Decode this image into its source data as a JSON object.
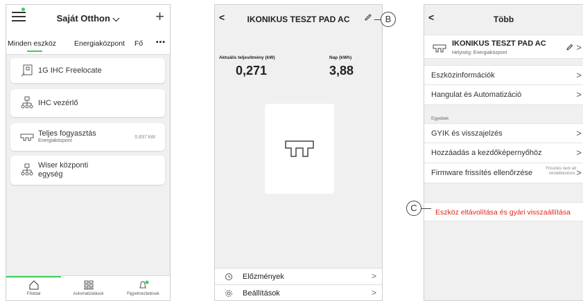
{
  "phone1": {
    "title": "Saját Otthon",
    "tabs": [
      "Minden eszköz",
      "Energiaközpont",
      "Fő"
    ],
    "more": "•••",
    "devices": [
      {
        "label": "1G IHC Freelocate",
        "icon": "freelocate-switch-icon"
      },
      {
        "label": "IHC vezérlő",
        "icon": "controller-hub-icon"
      },
      {
        "label": "Teljes fogyasztás",
        "sub": "Energiaközpont",
        "value": "0,837 kW",
        "icon": "ac-pad-icon"
      },
      {
        "label": "Wiser központi\negység",
        "icon": "controller-hub-icon"
      }
    ],
    "nav": [
      {
        "label": "Főoldal",
        "icon": "home-icon"
      },
      {
        "label": "Automatizálások",
        "icon": "grid-icon"
      },
      {
        "label": "Figyelmeztetések",
        "icon": "bell-icon"
      }
    ]
  },
  "phone2": {
    "title": "IKONIKUS TESZT PAD AC",
    "metrics": [
      {
        "label": "Aktuális teljesítmény (kW)",
        "value": "0,271"
      },
      {
        "label": "Nap (kWh)",
        "value": "3,88"
      }
    ],
    "rows": [
      {
        "label": "Előzmények",
        "icon": "history-icon"
      },
      {
        "label": "Beállítások",
        "icon": "settings-icon"
      }
    ]
  },
  "phone3": {
    "title": "Több",
    "device_name": "IKONIKUS TESZT PAD AC",
    "device_location": "Helyiség: Energiaközpont",
    "rows_top": [
      "Eszközinformációk",
      "Hangulat és Automatizáció"
    ],
    "section": "Egyebek",
    "rows_other": [
      "GYIK és visszajelzés",
      "Hozzáadás a kezdőképernyőhöz",
      "Firmware frissítés ellenőrzése"
    ],
    "firmware_note": "Frissítés nem áll\nrendelkezésre.",
    "remove": "Eszköz eltávolítása és gyári visszaállítása"
  },
  "callouts": {
    "b": "B",
    "c": "C"
  },
  "colors": {
    "accent": "#3dcd58",
    "danger": "#e2231a"
  }
}
